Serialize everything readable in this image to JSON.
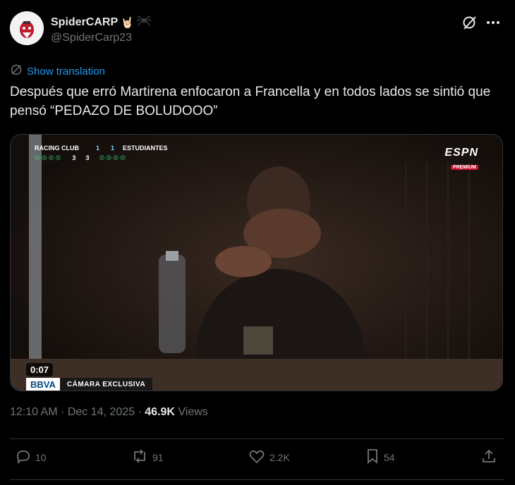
{
  "author": {
    "display_name": "SpiderCARP",
    "handle": "@SpiderCarp23"
  },
  "tweet": {
    "translation_link": "Show translation",
    "text": "Después que erró Martirena enfocaron a Francella y en todos lados se sintió que pensó “PEDAZO DE BOLUDOOO”"
  },
  "video": {
    "scorebug": {
      "home_team": "RACING CLUB",
      "home_score": "1",
      "home_pens": "3",
      "away_team": "ESTUDIANTES",
      "away_score": "1",
      "away_pens": "3"
    },
    "network": "ESPN",
    "network_sub": "PREMIUM",
    "duration": "0:07",
    "sponsor": "BBVA",
    "caption": "CÁMARA EXCLUSIVA"
  },
  "meta": {
    "time": "12:10 AM",
    "separator": " · ",
    "date": "Dec 14, 2025",
    "views_count": "46.9K",
    "views_label": " Views"
  },
  "actions": {
    "replies": "10",
    "reposts": "91",
    "likes": "2.2K",
    "bookmarks": "54"
  },
  "colors": {
    "background": "#000000",
    "text_primary": "#e7e9ea",
    "text_secondary": "#71767b",
    "link": "#1d9bf0",
    "divider": "#2f3336"
  },
  "icons": [
    "spider-icon",
    "rock-hand-icon",
    "grok-icon",
    "more-icon",
    "translate-icon",
    "reply-icon",
    "repost-icon",
    "like-icon",
    "bookmark-icon",
    "share-icon"
  ]
}
